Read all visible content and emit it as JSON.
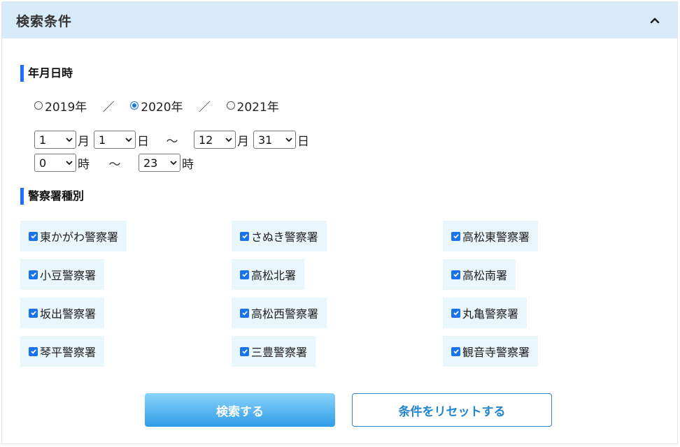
{
  "header": {
    "title": "検索条件"
  },
  "datetime": {
    "section_title": "年月日時",
    "years": [
      {
        "label": "2019年",
        "checked": false
      },
      {
        "label": "2020年",
        "checked": true
      },
      {
        "label": "2021年",
        "checked": false
      }
    ],
    "year_separator": "／",
    "start_month": "1",
    "start_day": "1",
    "end_month": "12",
    "end_day": "31",
    "start_hour": "0",
    "end_hour": "23",
    "unit_month": "月",
    "unit_day": "日",
    "unit_hour": "時",
    "tilde": "～"
  },
  "stations": {
    "section_title": "警察署種別",
    "items": [
      {
        "label": "東かがわ警察署",
        "checked": true
      },
      {
        "label": "さぬき警察署",
        "checked": true
      },
      {
        "label": "高松東警察署",
        "checked": true
      },
      {
        "label": "小豆警察署",
        "checked": true
      },
      {
        "label": "高松北署",
        "checked": true
      },
      {
        "label": "高松南署",
        "checked": true
      },
      {
        "label": "坂出警察署",
        "checked": true
      },
      {
        "label": "高松西警察署",
        "checked": true
      },
      {
        "label": "丸亀警察署",
        "checked": true
      },
      {
        "label": "琴平警察署",
        "checked": true
      },
      {
        "label": "三豊警察署",
        "checked": true
      },
      {
        "label": "観音寺警察署",
        "checked": true
      }
    ]
  },
  "buttons": {
    "search": "検索する",
    "reset": "条件をリセットする"
  },
  "colors": {
    "header_bg": "#d7ebf8",
    "accent": "#1f6fff",
    "checkbox": "#1a73e8",
    "item_bg": "#e9f6fc",
    "button_gradient_top": "#8ad4fb",
    "button_gradient_bottom": "#2f9ce8"
  }
}
